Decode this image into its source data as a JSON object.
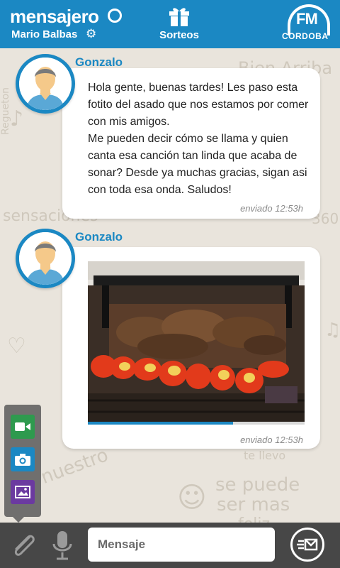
{
  "header": {
    "app_name": "mensajero",
    "user_name": "Mario Balbas",
    "settings_icon": "gear-icon",
    "sorteos_label": "Sorteos",
    "station_logo_top": "FM",
    "station_logo_bottom": "CORDOBA"
  },
  "background_words": [
    "Bien Arriba",
    "sensaciones",
    "Regueton",
    "360",
    "se puede",
    "ser mas",
    "feliz",
    "te llevo",
    "nuestro"
  ],
  "messages": [
    {
      "sender": "Gonzalo",
      "type": "text",
      "text": "Hola gente, buenas tardes! Les paso esta fotito del asado que nos estamos por comer con mis amigos.\nMe pueden decir cómo se llama y quien canta esa canción tan linda que acaba de sonar? Desde ya muchas gracias, sigan asi con toda esa onda. Saludos!",
      "time": "enviado 12:53h"
    },
    {
      "sender": "Gonzalo",
      "type": "image",
      "image_subject": "asado-grill-photo",
      "progress": 0.67,
      "time": "enviado 12:53h"
    }
  ],
  "attach_menu": [
    {
      "name": "video-icon",
      "color": "#2e9a4e"
    },
    {
      "name": "camera-icon",
      "color": "#1b88c3"
    },
    {
      "name": "gallery-icon",
      "color": "#6b3aa0"
    }
  ],
  "composer": {
    "placeholder": "Mensaje",
    "attach_icon": "paperclip-icon",
    "mic_icon": "microphone-icon",
    "send_icon": "send-icon"
  },
  "colors": {
    "primary": "#1b88c3",
    "background": "#e9e4dc",
    "bottom_bar": "#474747"
  }
}
